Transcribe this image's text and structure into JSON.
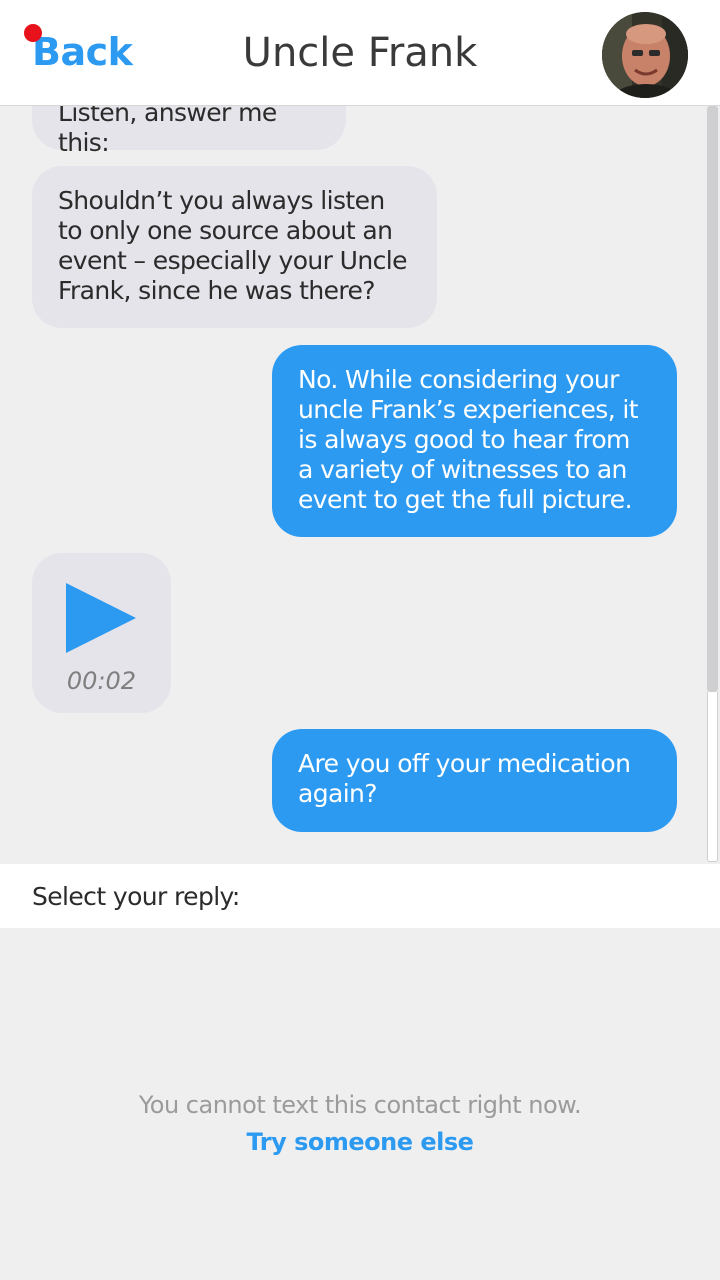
{
  "header": {
    "back_label": "Back",
    "title": "Uncle Frank"
  },
  "messages": [
    {
      "from": "contact",
      "text": "Listen, answer me this:"
    },
    {
      "from": "contact",
      "text": "Shouldn’t you always listen to only one source about an event – especially your Uncle Frank, since he was there?"
    },
    {
      "from": "me",
      "text": "No. While considering your uncle Frank’s experiences, it is always good to hear from a variety of witnesses to an event to get the full picture."
    },
    {
      "from": "contact",
      "type": "voice",
      "duration": "00:02"
    },
    {
      "from": "me",
      "text": "Are you off your medication again?"
    }
  ],
  "reply": {
    "label": "Select your reply:",
    "unavailable_text": "You cannot text this contact right now.",
    "try_other_label": "Try someone else"
  },
  "colors": {
    "accent": "#2d9af2",
    "notification": "#e8121c",
    "incoming_bubble": "#e4e4ea",
    "outgoing_bubble": "#2d9af2"
  },
  "icons": {
    "back": "back-button",
    "notification": "notification-dot",
    "play": "play-icon",
    "avatar": "contact-avatar"
  }
}
